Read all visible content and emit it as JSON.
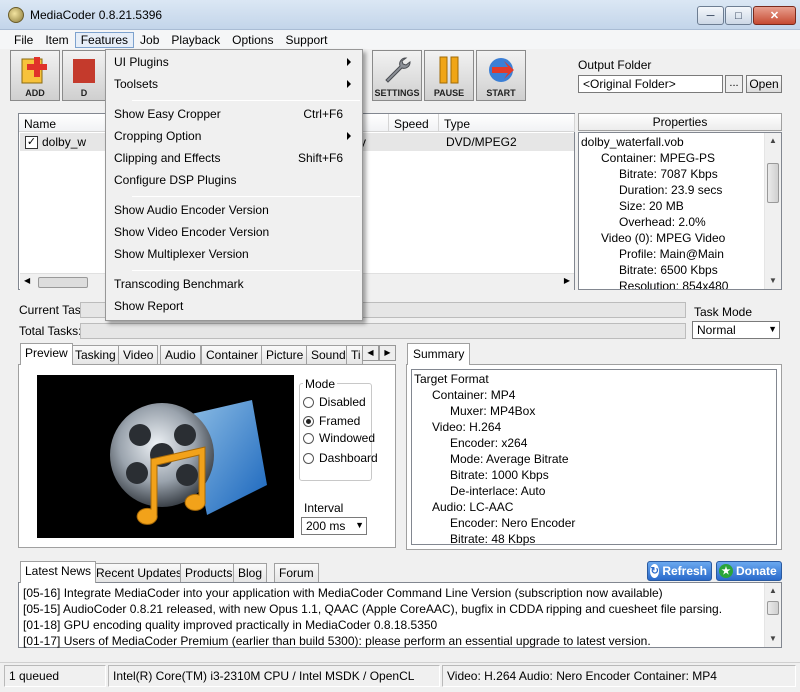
{
  "window": {
    "title": "MediaCoder 0.8.21.5396"
  },
  "menubar": [
    "File",
    "Item",
    "Features",
    "Job",
    "Playback",
    "Options",
    "Support"
  ],
  "toolbar": {
    "add": "ADD",
    "d_partial": "D",
    "settings": "SETTINGS",
    "pause": "PAUSE",
    "start": "START"
  },
  "output": {
    "label": "Output Folder",
    "value": "<Original Folder>",
    "browse": "...",
    "open": "Open"
  },
  "filelist": {
    "columns": [
      "Name",
      "Speed",
      "Type"
    ],
    "row": {
      "name": "dolby_w",
      "speed_partial": "y",
      "type": "DVD/MPEG2",
      "checked": true
    }
  },
  "properties": {
    "header": "Properties",
    "items": [
      {
        "text": "dolby_waterfall.vob",
        "level": 0
      },
      {
        "text": "Container: MPEG-PS",
        "level": 1
      },
      {
        "text": "Bitrate: 7087 Kbps",
        "level": 2
      },
      {
        "text": "Duration: 23.9 secs",
        "level": 2
      },
      {
        "text": "Size: 20 MB",
        "level": 2
      },
      {
        "text": "Overhead: 2.0%",
        "level": 2
      },
      {
        "text": "Video (0): MPEG Video",
        "level": 1
      },
      {
        "text": "Profile: Main@Main",
        "level": 2
      },
      {
        "text": "Bitrate: 6500 Kbps",
        "level": 2
      },
      {
        "text": "Resolution: 854x480",
        "level": 2
      }
    ]
  },
  "progress": {
    "current_label": "Current Tas",
    "total_label": "Total Tasks:"
  },
  "taskmode": {
    "label": "Task Mode",
    "value": "Normal"
  },
  "tabs": [
    "Preview",
    "Tasking",
    "Video",
    "Audio",
    "Container",
    "Picture",
    "Sound",
    "Ti"
  ],
  "preview": {
    "mode_title": "Mode",
    "modes": [
      {
        "label": "Disabled",
        "selected": false
      },
      {
        "label": "Framed",
        "selected": true
      },
      {
        "label": "Windowed",
        "selected": false
      },
      {
        "label": "Dashboard",
        "selected": false
      }
    ],
    "interval_label": "Interval",
    "interval_value": "200 ms"
  },
  "summary": {
    "tab": "Summary",
    "items": [
      {
        "text": "Target Format",
        "level": 0
      },
      {
        "text": "Container: MP4",
        "level": 1
      },
      {
        "text": "Muxer: MP4Box",
        "level": 2
      },
      {
        "text": "Video: H.264",
        "level": 1
      },
      {
        "text": "Encoder: x264",
        "level": 2
      },
      {
        "text": "Mode: Average Bitrate",
        "level": 2
      },
      {
        "text": "Bitrate: 1000 Kbps",
        "level": 2
      },
      {
        "text": "De-interlace: Auto",
        "level": 2
      },
      {
        "text": "Audio: LC-AAC",
        "level": 1
      },
      {
        "text": "Encoder: Nero Encoder",
        "level": 2
      },
      {
        "text": "Bitrate: 48 Kbps",
        "level": 2
      }
    ]
  },
  "news": {
    "tabs": [
      "Latest News",
      "Recent Updates",
      "Products",
      "Blog",
      "Forum"
    ],
    "lines": [
      "[05-16] Integrate MediaCoder into your application with MediaCoder Command Line Version (subscription now available)",
      "[05-15] AudioCoder 0.8.21 released, with new Opus 1.1, QAAC (Apple CoreAAC), bugfix in CDDA ripping and cuesheet file parsing.",
      "[01-18] GPU encoding quality improved practically in MediaCoder 0.8.18.5350",
      "[01-17] Users of MediaCoder Premium (earlier than build 5300): please perform an essential upgrade to latest version."
    ],
    "refresh": "Refresh",
    "donate": "Donate"
  },
  "status": {
    "queued": "1 queued",
    "cpu": "Intel(R) Core(TM) i3-2310M CPU  / Intel MSDK / OpenCL",
    "format": "Video: H.264  Audio: Nero Encoder  Container: MP4"
  },
  "features_menu": [
    {
      "label": "UI Plugins",
      "shortcut": "",
      "submenu": true
    },
    {
      "label": "Toolsets",
      "shortcut": "",
      "submenu": true
    },
    {
      "label": "Show Easy Cropper",
      "shortcut": "Ctrl+F6",
      "submenu": false
    },
    {
      "label": "Cropping Option",
      "shortcut": "",
      "submenu": true
    },
    {
      "label": "Clipping and Effects",
      "shortcut": "Shift+F6",
      "submenu": false
    },
    {
      "label": "Configure DSP Plugins",
      "shortcut": "",
      "submenu": false
    },
    {
      "label": "Show Audio Encoder Version",
      "shortcut": "",
      "submenu": false
    },
    {
      "label": "Show Video Encoder Version",
      "shortcut": "",
      "submenu": false
    },
    {
      "label": "Show Multiplexer Version",
      "shortcut": "",
      "submenu": false
    },
    {
      "label": "Transcoding Benchmark",
      "shortcut": "",
      "submenu": false
    },
    {
      "label": "Show Report",
      "shortcut": "",
      "submenu": false
    }
  ]
}
